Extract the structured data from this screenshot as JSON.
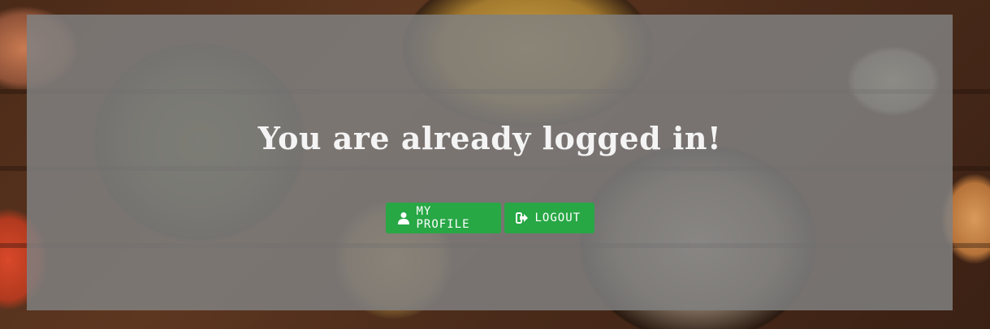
{
  "page": {
    "title": "You are already logged in!"
  },
  "buttons": {
    "profile_label": "MY PROFILE",
    "profile_icon": "user-icon",
    "logout_label": "LOGOUT",
    "logout_icon": "sign-out-icon"
  },
  "colors": {
    "button_bg": "#28a745",
    "overlay": "#808080",
    "title_text": "#f4f4f4"
  }
}
